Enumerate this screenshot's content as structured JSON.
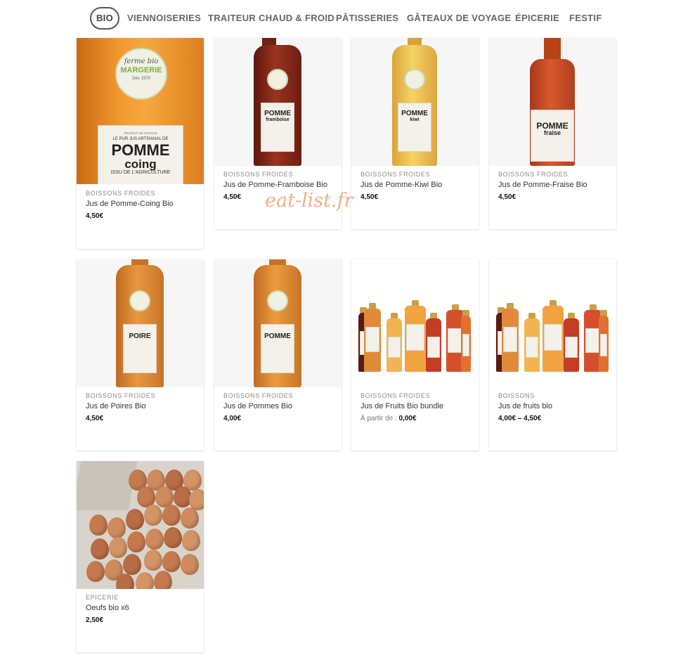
{
  "nav": {
    "items": [
      {
        "label": "BIO",
        "active": true
      },
      {
        "label": "VIENNOISERIES",
        "active": false
      },
      {
        "label": "TRAITEUR CHAUD & FROID",
        "active": false
      },
      {
        "label": "PÂTISSERIES",
        "active": false
      },
      {
        "label": "GÂTEAUX DE VOYAGE",
        "active": false
      },
      {
        "label": "ÉPICERIE",
        "active": false
      },
      {
        "label": "FESTIF",
        "active": false
      }
    ]
  },
  "watermark": "eat-list.fr",
  "products": [
    {
      "category": "BOISSONS FROIDES",
      "name": "Jus de Pomme-Coing Bio",
      "price": "4,50€",
      "image": "pomme-coing-bottle",
      "label_top": "LE PUR JUS ARTISANAL DE",
      "label_main": "POMME",
      "label_sub": "coing",
      "label_bottom": "ISSU DE L'AGRICULTURE",
      "brand_script": "ferme bio",
      "brand": "MARGERIE",
      "brand_year": "Dès 1979",
      "label_small": "PRODUIT DE FRANCE"
    },
    {
      "category": "BOISSONS FROIDES",
      "name": "Jus de Pomme-Framboise Bio",
      "price": "4,50€",
      "image": "pomme-framboise-bottle",
      "label_main": "POMME",
      "label_sub": "framboise"
    },
    {
      "category": "BOISSONS FROIDES",
      "name": "Jus de Pomme-Kiwi Bio",
      "price": "4,50€",
      "image": "pomme-kiwi-bottle",
      "label_main": "POMME",
      "label_sub": "kiwi"
    },
    {
      "category": "BOISSONS FROIDES",
      "name": "Jus de Pomme-Fraise Bio",
      "price": "4,50€",
      "image": "pomme-fraise-bottle",
      "label_main": "POMME",
      "label_sub": "fraise"
    },
    {
      "category": "BOISSONS FROIDES",
      "name": "Jus de Poires Bio",
      "price": "4,50€",
      "image": "poire-bottle",
      "label_main": "POIRE"
    },
    {
      "category": "BOISSONS FROIDES",
      "name": "Jus de Pommes Bio",
      "price": "4,00€",
      "image": "pomme-bottle",
      "label_main": "POMME"
    },
    {
      "category": "BOISSONS FROIDES",
      "name": "Jus de Fruits Bio bundle",
      "price_prefix": "À partir de :",
      "price": "0,00€",
      "image": "juice-bundle"
    },
    {
      "category": "BOISSONS",
      "name": "Jus de fruits bio",
      "price": "4,00€ – 4,50€",
      "image": "juice-bundle"
    },
    {
      "category": "EPICERIE",
      "name": "Oeufs bio x6",
      "price": "2,50€",
      "image": "eggs-carton"
    }
  ],
  "colors": {
    "apple_amber": "#e78a24",
    "raspberry": "#8c2a1a",
    "kiwi": "#efc34d",
    "strawberry": "#c95020",
    "pear": "#d98a38",
    "brand_green": "#7fae3b"
  }
}
